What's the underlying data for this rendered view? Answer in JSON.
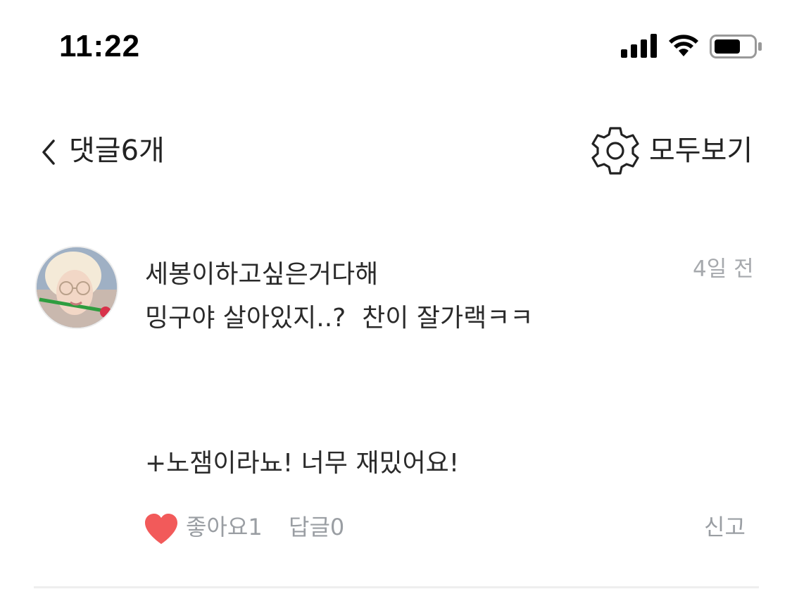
{
  "status_bar": {
    "time": "11:22"
  },
  "header": {
    "title": "댓글6개",
    "show_all_label": "모두보기"
  },
  "comment": {
    "author": "세봉이하고싶은거다해",
    "timestamp": "4일 전",
    "body_line1": "밍구야 살아있지..?  찬이 잘가랙ㅋㅋ",
    "body_line2": "+노잼이라뇨! 너무 재밌어요!",
    "like_label": "좋아요1",
    "reply_label": "답글0",
    "report_label": "신고"
  },
  "colors": {
    "like_heart": "#f25a5a",
    "meta_text": "#9a9ea3",
    "divider": "#eeeeee"
  }
}
